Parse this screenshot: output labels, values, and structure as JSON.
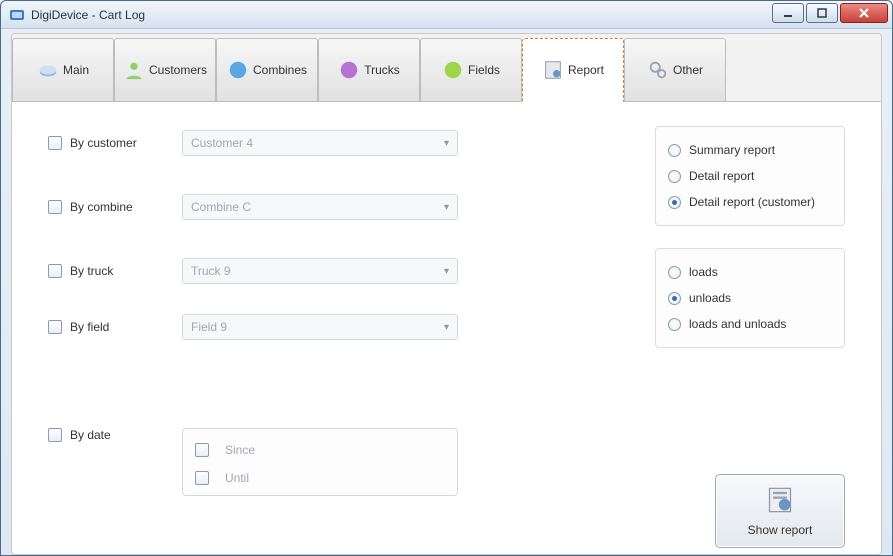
{
  "window": {
    "title": "DigiDevice - Cart Log"
  },
  "tabs": [
    {
      "label": "Main"
    },
    {
      "label": "Customers"
    },
    {
      "label": "Combines"
    },
    {
      "label": "Trucks"
    },
    {
      "label": "Fields"
    },
    {
      "label": "Report"
    },
    {
      "label": "Other"
    }
  ],
  "active_tab": 5,
  "filters": {
    "customer": {
      "label": "By customer",
      "value": "Customer 4"
    },
    "combine": {
      "label": "By combine",
      "value": "Combine C"
    },
    "truck": {
      "label": "By truck",
      "value": "Truck 9"
    },
    "field": {
      "label": "By field",
      "value": "Field 9"
    },
    "date": {
      "label": "By date",
      "since": "Since",
      "until": "Until"
    }
  },
  "report_type": {
    "options": [
      {
        "label": "Summary report",
        "checked": false
      },
      {
        "label": "Detail report",
        "checked": false
      },
      {
        "label": "Detail report (customer)",
        "checked": true
      }
    ]
  },
  "load_type": {
    "options": [
      {
        "label": "loads",
        "checked": false
      },
      {
        "label": "unloads",
        "checked": true
      },
      {
        "label": "loads and unloads",
        "checked": false
      }
    ]
  },
  "show_button": "Show report"
}
